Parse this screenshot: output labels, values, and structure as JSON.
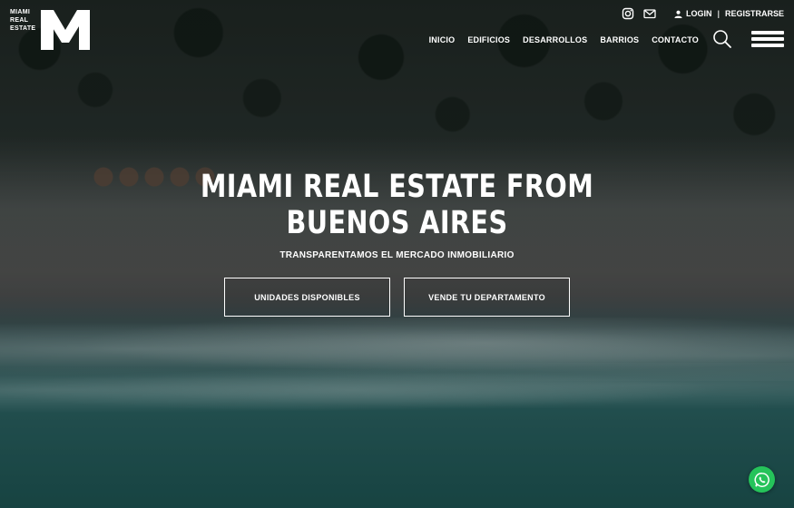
{
  "brand": {
    "logo_lines": [
      "MIAMI",
      "REAL",
      "ESTATE"
    ],
    "logo_letter": "M"
  },
  "topbar": {
    "instagram_icon": "instagram-icon",
    "mail_icon": "mail-icon",
    "login_icon": "user-icon",
    "login_label": "LOGIN",
    "separator": "|",
    "register_label": "REGISTRARSE"
  },
  "nav": {
    "items": [
      {
        "label": "INICIO"
      },
      {
        "label": "EDIFICIOS"
      },
      {
        "label": "DESARROLLOS"
      },
      {
        "label": "BARRIOS"
      },
      {
        "label": "CONTACTO"
      }
    ],
    "search_icon": "search-icon",
    "menu_icon": "hamburger-menu-icon"
  },
  "hero": {
    "title_line1": "MIAMI REAL ESTATE FROM",
    "title_line2": "BUENOS AIRES",
    "subtitle": "TRANSPARENTAMOS EL MERCADO INMOBILIARIO",
    "primary_button": "UNIDADES DISPONIBLES",
    "secondary_button": "VENDE TU DEPARTAMENTO"
  },
  "floating": {
    "whatsapp_icon": "whatsapp-icon",
    "whatsapp_color": "#25c35a"
  }
}
